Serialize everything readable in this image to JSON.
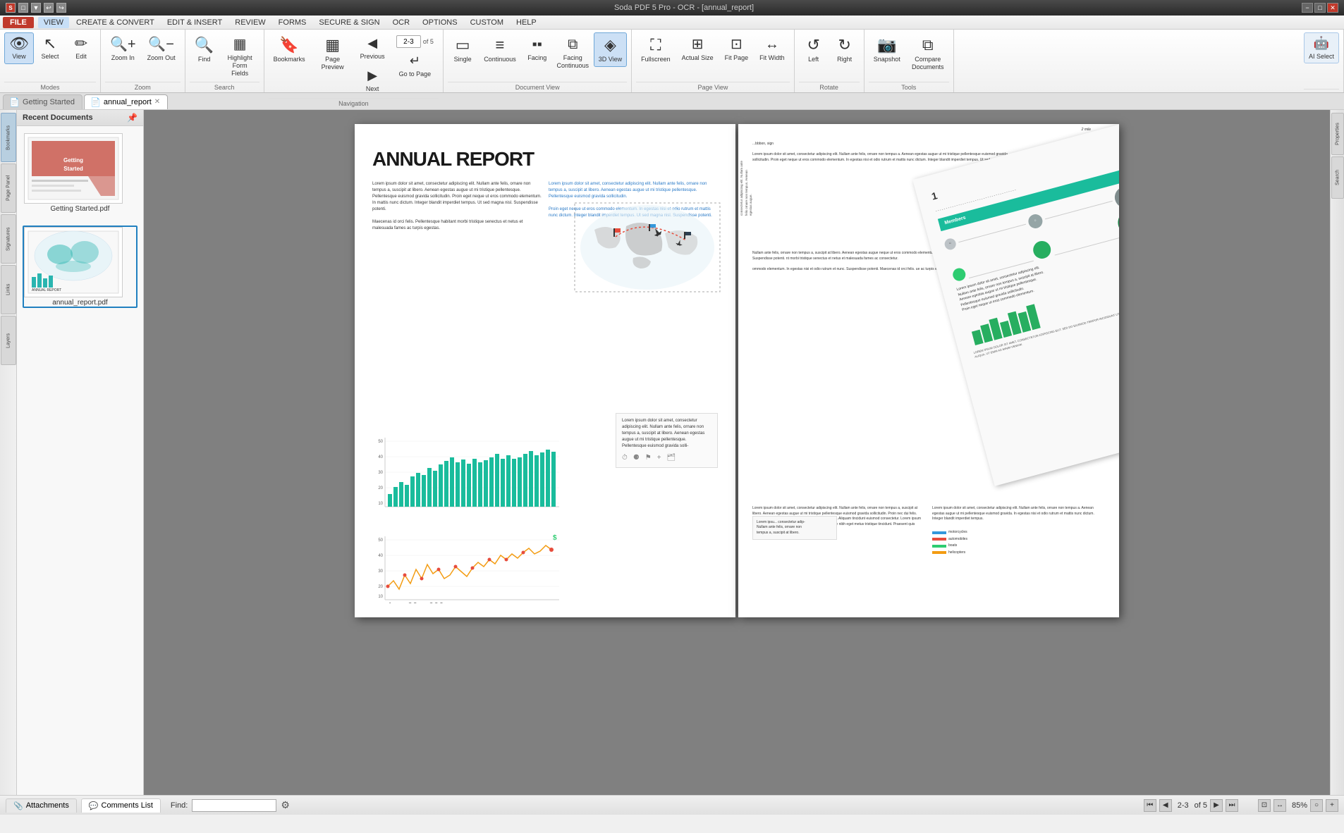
{
  "titlebar": {
    "title": "Soda PDF 5 Pro - OCR - [annual_report]",
    "left_icons": [
      "S",
      "□",
      "▼"
    ],
    "win_controls": [
      "−",
      "□",
      "✕"
    ]
  },
  "menubar": {
    "items": [
      "FILE",
      "VIEW",
      "CREATE & CONVERT",
      "EDIT & INSERT",
      "REVIEW",
      "FORMS",
      "SECURE & SIGN",
      "OCR",
      "OPTIONS",
      "CUSTOM",
      "HELP"
    ]
  },
  "ribbon": {
    "groups": [
      {
        "label": "Modes",
        "buttons": [
          {
            "id": "view",
            "label": "View",
            "icon": "👁",
            "active": true
          },
          {
            "id": "select",
            "label": "Select",
            "icon": "↖"
          },
          {
            "id": "edit",
            "label": "Edit",
            "icon": "✏"
          }
        ]
      },
      {
        "label": "Zoom",
        "buttons": [
          {
            "id": "zoom-in",
            "label": "Zoom In",
            "icon": "🔍"
          },
          {
            "id": "zoom-out",
            "label": "Zoom Out",
            "icon": "🔍"
          }
        ]
      },
      {
        "label": "Search",
        "buttons": [
          {
            "id": "find",
            "label": "Find",
            "icon": "🔍"
          },
          {
            "id": "highlight-form-fields",
            "label": "Highlight Form Fields",
            "icon": "▦",
            "active": false
          }
        ]
      },
      {
        "label": "Navigation",
        "buttons": [
          {
            "id": "bookmarks",
            "label": "Bookmarks",
            "icon": "🔖"
          },
          {
            "id": "page-preview",
            "label": "Page Preview",
            "icon": "□"
          },
          {
            "id": "previous",
            "label": "Previous",
            "icon": "◀"
          },
          {
            "id": "next",
            "label": "Next",
            "icon": "▶"
          }
        ],
        "page_input": "2-3",
        "page_of": "of 5",
        "goto_label": "Go to Page",
        "goto_icon": "↵"
      },
      {
        "label": "Document View",
        "buttons": [
          {
            "id": "single",
            "label": "Single",
            "icon": "□"
          },
          {
            "id": "continuous",
            "label": "Continuous",
            "icon": "≡"
          },
          {
            "id": "facing",
            "label": "Facing",
            "icon": "▪▪"
          },
          {
            "id": "facing-continuous",
            "label": "Facing Continuous",
            "icon": "▪▪"
          },
          {
            "id": "3d-view",
            "label": "3D View",
            "icon": "◈",
            "active": true
          }
        ]
      },
      {
        "label": "Page View",
        "buttons": [
          {
            "id": "fullscreen",
            "label": "Fullscreen",
            "icon": "⛶"
          },
          {
            "id": "actual-size",
            "label": "Actual Size",
            "icon": "⊞"
          },
          {
            "id": "fit-page",
            "label": "Fit Page",
            "icon": "⊡"
          },
          {
            "id": "fit-width",
            "label": "Fit Width",
            "icon": "↔"
          }
        ]
      },
      {
        "label": "Rotate",
        "buttons": [
          {
            "id": "rotate-left",
            "label": "Left",
            "icon": "↺"
          },
          {
            "id": "rotate-right",
            "label": "Right",
            "icon": "↻"
          }
        ]
      },
      {
        "label": "Tools",
        "buttons": [
          {
            "id": "snapshot",
            "label": "Snapshot",
            "icon": "📷"
          },
          {
            "id": "compare-documents",
            "label": "Compare Documents",
            "icon": "⧉"
          }
        ]
      }
    ]
  },
  "sidebar": {
    "tabs": [
      "Bookmarks",
      "Page Panel",
      "Signatures",
      "Links",
      "Layers"
    ]
  },
  "recent_docs": {
    "title": "Recent Documents",
    "docs": [
      {
        "name": "Getting Started.pdf",
        "selected": false
      },
      {
        "name": "annual_report.pdf",
        "selected": true
      }
    ]
  },
  "tabs": [
    {
      "label": "Getting Started",
      "icon": "📄",
      "active": false,
      "closable": false
    },
    {
      "label": "annual_report",
      "icon": "📄",
      "active": true,
      "closable": true
    }
  ],
  "document": {
    "title": "ANNUAL REPORT",
    "lorem_text": "Lorem ipsum dolor sit amet, consectetur adipiscing elit. Nullam ante felis, ornare non tempus a, suscipit at libero. Aenean egestas augue ut mi tristique pellentesque. Pellentesque euismod gravida sollicitudin. Proin eget neque ut eros commodo elementum. In mattis nunc dictum. Integer blandit imperdiet tempus. Ut sed magna nisl. Suspendisse potenti.",
    "lorem_text2": "Lorem ipsum dolor sit amet, consectetur adipiscing elit. Nullam ante felis, ornare non tempus a, suscipit at libero. Aenean egestas augue ut mi tristique pellentesque. Pellentesque euismod gravida sollicitudin. Proin eget neque ut eros commodo elementum. In egestas nisi et odio rutrum et mattis nunc dictum. Integer blandit imperdiet tempus. Ut sed magna nisl. Suspendisse potenti.",
    "maecenas_text": "Maecenas id orci felis. Pellentesque habitant morbi tristique senectus et netus et malesuada fames ac turpis egestas.",
    "page_range": "2-3",
    "total_pages": "5"
  },
  "bottom_tabs": [
    {
      "label": "Attachments",
      "icon": "📎",
      "active": false
    },
    {
      "label": "Comments List",
      "icon": "💬",
      "active": false
    }
  ],
  "find": {
    "label": "Find:",
    "value": ""
  },
  "navigation": {
    "first": "⏮",
    "prev": "◀",
    "page_display": "2-3",
    "of": "of 5",
    "next": "▶",
    "last": "⏭"
  },
  "zoom": {
    "display": "85%"
  },
  "right_panel": {
    "tabs": [
      "Properties",
      "Search"
    ]
  },
  "bar_chart_data": [
    8,
    15,
    22,
    18,
    25,
    30,
    28,
    35,
    32,
    38,
    42,
    45,
    40,
    43,
    38,
    44,
    40,
    42,
    45,
    48,
    43,
    46,
    42,
    40,
    45,
    48,
    50,
    44,
    46,
    50
  ],
  "line_chart_data": [
    18,
    22,
    15,
    25,
    20,
    28,
    22,
    30,
    25,
    28,
    22,
    25,
    30,
    28,
    25,
    30,
    35,
    32,
    38,
    35,
    42,
    38,
    42,
    46,
    43,
    48,
    45,
    50,
    48,
    52
  ]
}
